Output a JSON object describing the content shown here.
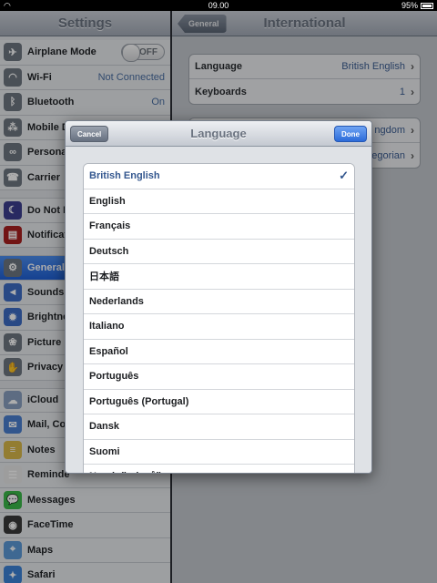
{
  "status": {
    "time": "09.00",
    "battery": "95%"
  },
  "settings": {
    "title": "Settings",
    "items": [
      {
        "label": "Airplane Mode",
        "toggle": "OFF",
        "icon": "airplane-icon",
        "color": "#6e7680",
        "glyph": "✈"
      },
      {
        "label": "Wi-Fi",
        "value": "Not Connected",
        "icon": "wifi-icon",
        "color": "#6e7680",
        "glyph": "◠"
      },
      {
        "label": "Bluetooth",
        "value": "On",
        "icon": "bluetooth-icon",
        "color": "#6e7680",
        "glyph": "ᛒ"
      },
      {
        "label": "Mobile D",
        "icon": "mobile-data-icon",
        "color": "#6e7680",
        "glyph": "⁂"
      },
      {
        "label": "Persona",
        "icon": "personal-hotspot-icon",
        "color": "#6e7680",
        "glyph": "∞"
      },
      {
        "label": "Carrier",
        "icon": "carrier-icon",
        "color": "#6e7680",
        "glyph": "☎"
      },
      {
        "label": "Do Not D",
        "icon": "moon-icon",
        "color": "#3d3f8f",
        "glyph": "☾"
      },
      {
        "label": "Notificati",
        "icon": "notifications-icon",
        "color": "#a82020",
        "glyph": "▤"
      },
      {
        "label": "General",
        "icon": "gear-icon",
        "color": "#6e7680",
        "glyph": "⚙"
      },
      {
        "label": "Sounds",
        "icon": "speaker-icon",
        "color": "#3d6cc4",
        "glyph": "◄"
      },
      {
        "label": "Brightne",
        "icon": "brightness-icon",
        "color": "#3d6cc4",
        "glyph": "✹"
      },
      {
        "label": "Picture F",
        "icon": "picture-frame-icon",
        "color": "#6e7680",
        "glyph": "❀"
      },
      {
        "label": "Privacy",
        "icon": "privacy-icon",
        "color": "#6e7680",
        "glyph": "✋"
      },
      {
        "label": "iCloud",
        "icon": "cloud-icon",
        "color": "#8aa0c0",
        "glyph": "☁"
      },
      {
        "label": "Mail, Co",
        "icon": "mail-icon",
        "color": "#4a7fd0",
        "glyph": "✉"
      },
      {
        "label": "Notes",
        "icon": "notes-icon",
        "color": "#d9b84a",
        "glyph": "≡"
      },
      {
        "label": "Reminde",
        "icon": "reminders-icon",
        "color": "#e7e7e7",
        "glyph": "☰"
      },
      {
        "label": "Messages",
        "icon": "messages-icon",
        "color": "#3cb84a",
        "glyph": "💬"
      },
      {
        "label": "FaceTime",
        "icon": "facetime-icon",
        "color": "#3a3a3a",
        "glyph": "◉"
      },
      {
        "label": "Maps",
        "icon": "maps-icon",
        "color": "#5c9ad8",
        "glyph": "⌖"
      },
      {
        "label": "Safari",
        "icon": "safari-icon",
        "color": "#3b82d8",
        "glyph": "✦"
      }
    ]
  },
  "international": {
    "back_label": "General",
    "title": "International",
    "rows1": [
      {
        "label": "Language",
        "value": "British English"
      },
      {
        "label": "Keyboards",
        "value": "1"
      }
    ],
    "rows2": [
      {
        "label": "",
        "value": "ngdom"
      },
      {
        "label": "",
        "value": "egorian"
      }
    ]
  },
  "popup": {
    "title": "Language",
    "cancel_label": "Cancel",
    "done_label": "Done",
    "check": "✓",
    "languages": [
      "British English",
      "English",
      "Français",
      "Deutsch",
      "日本語",
      "Nederlands",
      "Italiano",
      "Español",
      "Português",
      "Português (Portugal)",
      "Dansk",
      "Suomi",
      "Norsk (bokmål)"
    ],
    "selected_index": 0
  },
  "colors": {
    "accent": "#2c6bd9",
    "selected_text": "#34578f"
  }
}
